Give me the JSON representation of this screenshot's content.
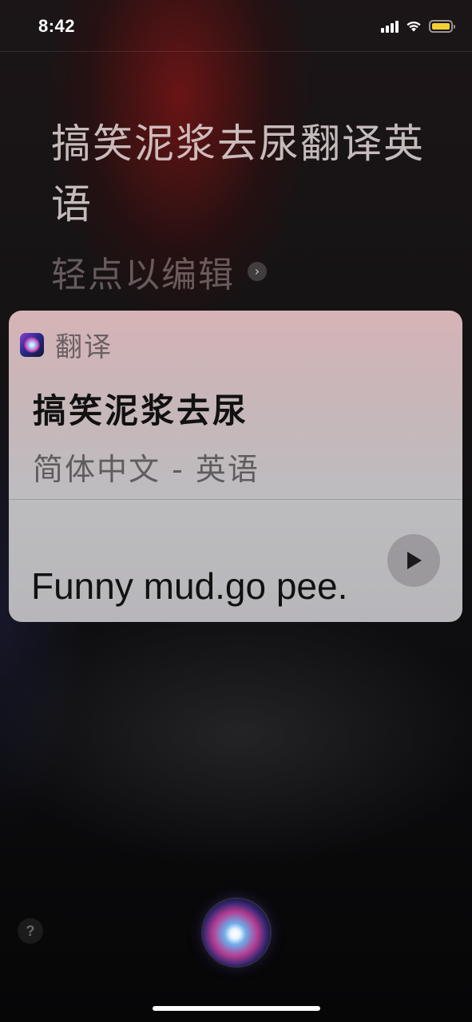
{
  "status_bar": {
    "time": "8:42",
    "icons": [
      "cellular-signal-icon",
      "wifi-icon",
      "battery-icon"
    ],
    "battery_color": "#f5d033"
  },
  "siri": {
    "query": "搞笑泥浆去尿翻译英语",
    "tap_to_edit": "轻点以编辑"
  },
  "card": {
    "app_name": "翻译",
    "source_phrase": "搞笑泥浆去尿",
    "language_pair": "简体中文 - 英语",
    "translation": "Funny mud.go pee."
  },
  "bottom": {
    "help_label": "?"
  }
}
